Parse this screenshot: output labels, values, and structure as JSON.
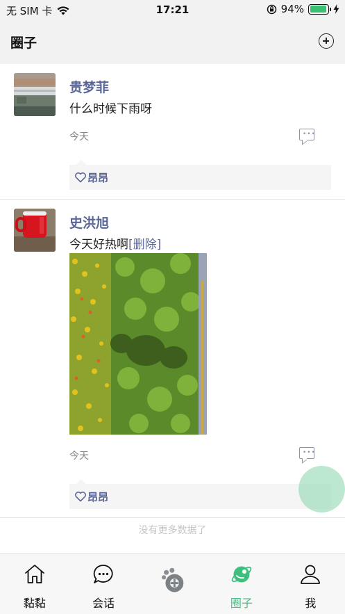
{
  "status_bar": {
    "carrier": "无 SIM 卡",
    "time": "17:21",
    "battery_percent": "94%",
    "battery_level": 0.94,
    "icons": [
      "wifi-icon",
      "orientation-lock-icon",
      "battery-icon",
      "charging-icon"
    ]
  },
  "header": {
    "title": "圈子",
    "add_icon": "plus-circle-icon"
  },
  "posts": [
    {
      "author": "贵梦菲",
      "content": "什么时候下雨呀",
      "time": "今天",
      "likes": [
        "昂昂"
      ]
    },
    {
      "author": "史洪旭",
      "content": "今天好热啊",
      "delete_label": "[删除]",
      "time": "今天",
      "likes": [
        "昂昂"
      ]
    }
  ],
  "footer_text": "没有更多数据了",
  "tabs": [
    {
      "label": "黏黏",
      "icon": "home-icon"
    },
    {
      "label": "会话",
      "icon": "chat-icon"
    },
    {
      "label": "",
      "icon": "paw-logo-icon"
    },
    {
      "label": "圈子",
      "icon": "planet-icon",
      "active": true
    },
    {
      "label": "我",
      "icon": "user-icon"
    }
  ],
  "colors": {
    "accent": "#3fbf7f",
    "author": "#5b6797",
    "battery": "#38c172",
    "fab": "#86d6aa"
  }
}
